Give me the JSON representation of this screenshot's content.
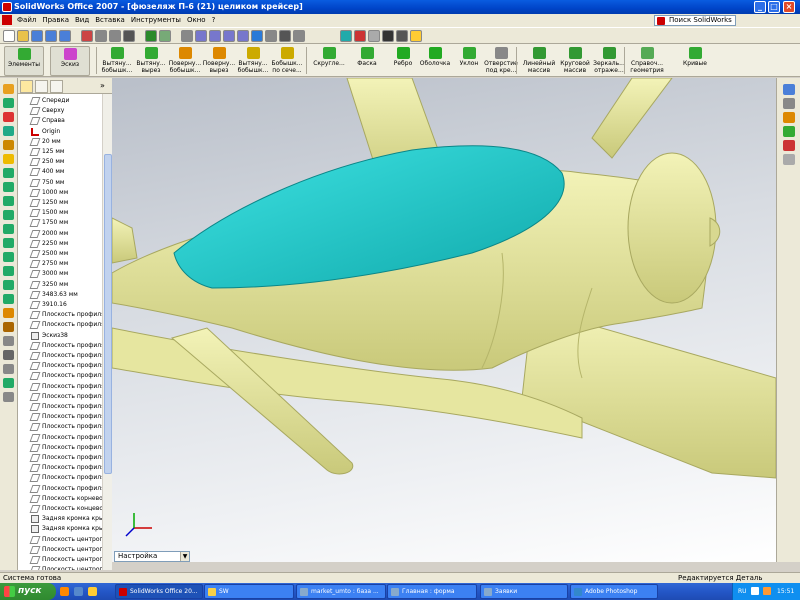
{
  "app": {
    "title": "SolidWorks Office 2007 - [фюзеляж П-6 (21) целиком крейсер]"
  },
  "window_controls": {
    "minimize": "_",
    "maximize": "□",
    "close": "×"
  },
  "menu": {
    "items": [
      "Файл",
      "Правка",
      "Вид",
      "Вставка",
      "Инструменты",
      "Окно",
      "?"
    ],
    "search_value": "Поиск SolidWorks"
  },
  "commands": [
    {
      "label": "Элементы",
      "icon": "features-icon",
      "main": true
    },
    {
      "label": "Эскиз",
      "icon": "sketch-icon",
      "main": true
    },
    {
      "label": "Вытяну... бобышк...",
      "icon": "extruded-boss-icon"
    },
    {
      "label": "Вытяну... вырез",
      "icon": "extruded-cut-icon"
    },
    {
      "label": "Поверну... бобышк...",
      "icon": "revolved-boss-icon"
    },
    {
      "label": "Поверну... вырез",
      "icon": "revolved-cut-icon"
    },
    {
      "label": "Вытяну... бобышк...",
      "icon": "swept-boss-icon"
    },
    {
      "label": "Бобышк... по сече...",
      "icon": "loft-boss-icon"
    },
    {
      "label": "Скругле...",
      "icon": "fillet-icon"
    },
    {
      "label": "Фаска",
      "icon": "chamfer-icon"
    },
    {
      "label": "Ребро",
      "icon": "rib-icon"
    },
    {
      "label": "Оболочка",
      "icon": "shell-icon"
    },
    {
      "label": "Уклон",
      "icon": "draft-icon"
    },
    {
      "label": "Отверстие под кре...",
      "icon": "hole-wizard-icon"
    },
    {
      "label": "Линейный массив",
      "icon": "linear-pattern-icon"
    },
    {
      "label": "Круговой массив",
      "icon": "circular-pattern-icon"
    },
    {
      "label": "Зеркаль... отраже...",
      "icon": "mirror-icon"
    },
    {
      "label": "Справоч... геометрия",
      "icon": "reference-geometry-icon"
    },
    {
      "label": "Кривые",
      "icon": "curves-icon"
    }
  ],
  "tree": [
    {
      "label": "Спереди",
      "icon": "plane-icon"
    },
    {
      "label": "Сверху",
      "icon": "plane-icon"
    },
    {
      "label": "Справа",
      "icon": "plane-icon"
    },
    {
      "label": "Origin",
      "icon": "origin-icon"
    },
    {
      "label": "20 мм",
      "icon": "plane-icon"
    },
    {
      "label": "125 мм",
      "icon": "plane-icon"
    },
    {
      "label": "250 мм",
      "icon": "plane-icon"
    },
    {
      "label": "400 мм",
      "icon": "plane-icon"
    },
    {
      "label": "750 мм",
      "icon": "plane-icon"
    },
    {
      "label": "1000 мм",
      "icon": "plane-icon"
    },
    {
      "label": "1250 мм",
      "icon": "plane-icon"
    },
    {
      "label": "1500 мм",
      "icon": "plane-icon"
    },
    {
      "label": "1750 мм",
      "icon": "plane-icon"
    },
    {
      "label": "2000 мм",
      "icon": "plane-icon"
    },
    {
      "label": "2250 мм",
      "icon": "plane-icon"
    },
    {
      "label": "2500 мм",
      "icon": "plane-icon"
    },
    {
      "label": "2750 мм",
      "icon": "plane-icon"
    },
    {
      "label": "3000 мм",
      "icon": "plane-icon"
    },
    {
      "label": "3250 мм",
      "icon": "plane-icon"
    },
    {
      "label": "3483.63 мм",
      "icon": "plane-icon"
    },
    {
      "label": "3910.16",
      "icon": "plane-icon"
    },
    {
      "label": "Плоскость профиля",
      "icon": "plane-icon"
    },
    {
      "label": "Плоскость профиля",
      "icon": "plane-icon"
    },
    {
      "label": "Эскиз38",
      "icon": "sketch-icon"
    },
    {
      "label": "Плоскость профиля",
      "icon": "plane-icon"
    },
    {
      "label": "Плоскость профиля",
      "icon": "plane-icon"
    },
    {
      "label": "Плоскость профиля",
      "icon": "plane-icon"
    },
    {
      "label": "Плоскость профиля",
      "icon": "plane-icon"
    },
    {
      "label": "Плоскость профиля",
      "icon": "plane-icon"
    },
    {
      "label": "Плоскость профиля",
      "icon": "plane-icon"
    },
    {
      "label": "Плоскость профиля",
      "icon": "plane-icon"
    },
    {
      "label": "Плоскость профиля",
      "icon": "plane-icon"
    },
    {
      "label": "Плоскость профиля",
      "icon": "plane-icon"
    },
    {
      "label": "Плоскость профиля",
      "icon": "plane-icon"
    },
    {
      "label": "Плоскость профиля",
      "icon": "plane-icon"
    },
    {
      "label": "Плоскость профиля",
      "icon": "plane-icon"
    },
    {
      "label": "Плоскость профиля",
      "icon": "plane-icon"
    },
    {
      "label": "Плоскость профиля",
      "icon": "plane-icon"
    },
    {
      "label": "Плоскость профиля",
      "icon": "plane-icon"
    },
    {
      "label": "Плоскость корнево",
      "icon": "plane-icon"
    },
    {
      "label": "Плоскость концево",
      "icon": "plane-icon"
    },
    {
      "label": "Задняя кромка кры",
      "icon": "sketch-icon"
    },
    {
      "label": "Задняя кромка кры",
      "icon": "sketch-icon"
    },
    {
      "label": "Плоскость центропл",
      "icon": "plane-icon"
    },
    {
      "label": "Плоскость центропл",
      "icon": "plane-icon"
    },
    {
      "label": "Плоскость центропл",
      "icon": "plane-icon"
    },
    {
      "label": "Плоскость центропл",
      "icon": "plane-icon"
    }
  ],
  "viewport": {
    "config_dropdown": "Настройка",
    "body_color": "#e9e9a3",
    "canopy_color": "#1fc8c8"
  },
  "status": {
    "left": "Система готова",
    "right": "Редактируется Деталь"
  },
  "taskbar": {
    "start_label": "пуск",
    "tasks": [
      "SolidWorks Office 20...",
      "SW",
      "market_umto : база ...",
      "Главная : форма",
      "Заявки",
      "Adobe Photoshop"
    ],
    "lang": "RU",
    "clock": "15:51"
  }
}
